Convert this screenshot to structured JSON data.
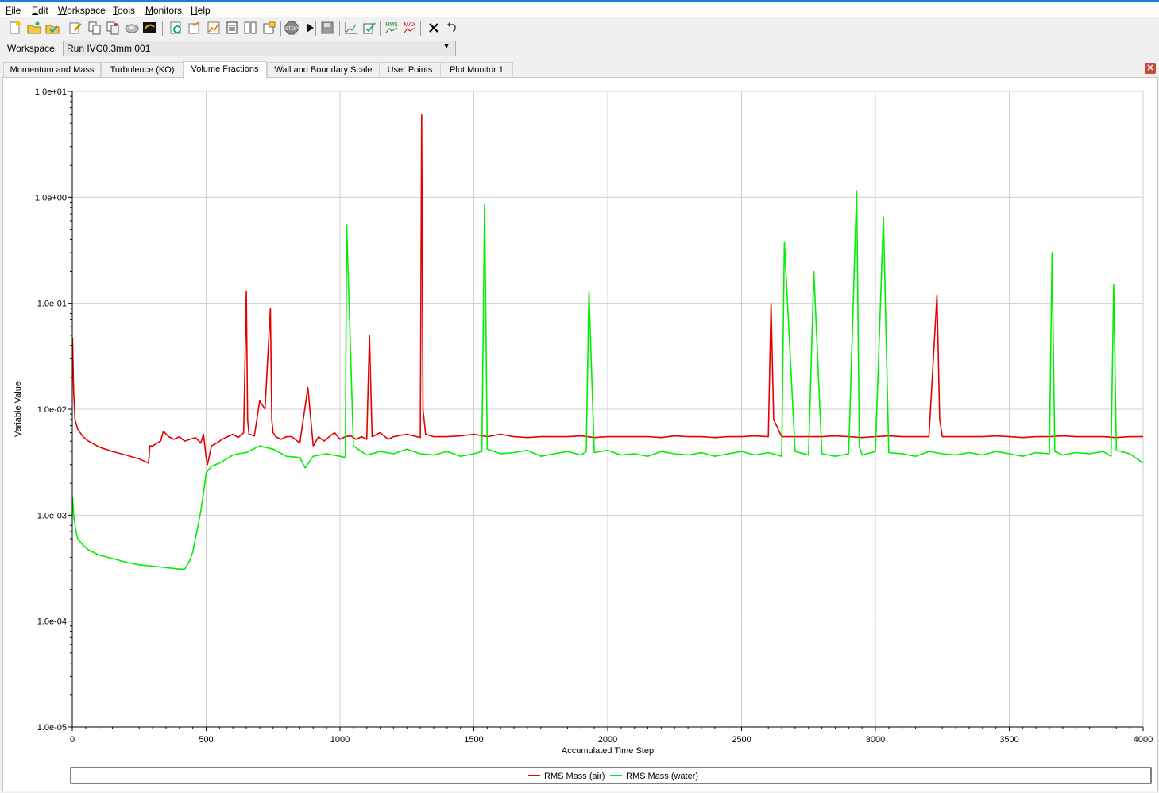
{
  "menu": [
    "File",
    "Edit",
    "Workspace",
    "Tools",
    "Monitors",
    "Help"
  ],
  "toolbar_icons": [
    "new-icon",
    "open-icon",
    "open-folder-icon",
    "edit-icon",
    "copy-icon",
    "copy-run-icon",
    "disk-icon",
    "monitor-icon",
    "refresh-icon",
    "run-icon",
    "chart-icon",
    "report-icon",
    "layout-icon",
    "tree-icon",
    "stop-icon",
    "play-icon",
    "save-icon",
    "plot-edit-icon",
    "plot-check-icon",
    "rms-icon",
    "max-icon",
    "close-icon",
    "undo-icon"
  ],
  "workspace": {
    "label": "Workspace",
    "value": "Run IVC0.3mm 001"
  },
  "tabs": [
    {
      "label": "Momentum and Mass"
    },
    {
      "label": "Turbulence (KO)"
    },
    {
      "label": "Volume Fractions",
      "active": true
    },
    {
      "label": "Wall and Boundary Scale"
    },
    {
      "label": "User Points"
    },
    {
      "label": "Plot Monitor 1"
    }
  ],
  "chart_data": {
    "type": "line",
    "xlabel": "Accumulated Time Step",
    "ylabel": "Variable Value",
    "yscale": "log",
    "xlim": [
      0,
      4000
    ],
    "ylim": [
      1e-05,
      10
    ],
    "xticks": [
      0,
      500,
      1000,
      1500,
      2000,
      2500,
      3000,
      3500,
      4000
    ],
    "xtick_labels": [
      "0",
      "500",
      "1000",
      "1500",
      "2000",
      "2500",
      "3000",
      "3500",
      "4000"
    ],
    "yticks": [
      1e-05,
      0.0001,
      0.001,
      0.01,
      0.1,
      1,
      10
    ],
    "ytick_labels": [
      "1.0e-05",
      "1.0e-04",
      "1.0e-03",
      "1.0e-02",
      "1.0e-01",
      "1.0e+00",
      "1.0e+01"
    ],
    "grid": true,
    "legend_position": "bottom",
    "series": [
      {
        "name": "RMS Mass (air)",
        "color": "#e60000",
        "x": [
          1,
          5,
          10,
          20,
          40,
          60,
          100,
          150,
          200,
          250,
          285,
          290,
          300,
          330,
          340,
          360,
          380,
          400,
          420,
          440,
          460,
          480,
          490,
          500,
          505,
          520,
          540,
          560,
          580,
          600,
          620,
          640,
          650,
          655,
          660,
          680,
          700,
          720,
          740,
          745,
          750,
          760,
          780,
          800,
          820,
          850,
          880,
          900,
          920,
          940,
          960,
          980,
          1000,
          1020,
          1040,
          1060,
          1080,
          1100,
          1110,
          1120,
          1150,
          1180,
          1200,
          1250,
          1300,
          1305,
          1310,
          1320,
          1350,
          1400,
          1450,
          1500,
          1550,
          1600,
          1650,
          1700,
          1750,
          1800,
          1850,
          1900,
          1950,
          2000,
          2050,
          2100,
          2150,
          2200,
          2250,
          2300,
          2350,
          2400,
          2450,
          2500,
          2550,
          2600,
          2610,
          2620,
          2650,
          2700,
          2750,
          2800,
          2850,
          2900,
          2950,
          3000,
          3050,
          3100,
          3150,
          3200,
          3230,
          3240,
          3250,
          3300,
          3350,
          3400,
          3450,
          3500,
          3550,
          3600,
          3650,
          3700,
          3750,
          3800,
          3850,
          3900,
          3950,
          4000
        ],
        "y": [
          0.047,
          0.015,
          0.008,
          0.0065,
          0.0055,
          0.005,
          0.0044,
          0.004,
          0.0037,
          0.0034,
          0.0031,
          0.0045,
          0.0045,
          0.005,
          0.0062,
          0.0055,
          0.0052,
          0.0055,
          0.005,
          0.0052,
          0.0054,
          0.0048,
          0.0058,
          0.0035,
          0.003,
          0.0045,
          0.0048,
          0.0052,
          0.0055,
          0.0058,
          0.0054,
          0.006,
          0.13,
          0.008,
          0.0058,
          0.0056,
          0.012,
          0.01,
          0.09,
          0.008,
          0.006,
          0.0055,
          0.0052,
          0.0055,
          0.0055,
          0.0048,
          0.016,
          0.0045,
          0.0055,
          0.005,
          0.0055,
          0.006,
          0.0052,
          0.0055,
          0.0056,
          0.0052,
          0.0055,
          0.0052,
          0.05,
          0.0055,
          0.006,
          0.0052,
          0.0055,
          0.0058,
          0.0054,
          6.0,
          0.01,
          0.0058,
          0.0055,
          0.0055,
          0.0056,
          0.0058,
          0.0055,
          0.0058,
          0.0055,
          0.0054,
          0.0055,
          0.0055,
          0.0055,
          0.0056,
          0.0054,
          0.0055,
          0.0055,
          0.0055,
          0.0055,
          0.0054,
          0.0056,
          0.0055,
          0.0055,
          0.0054,
          0.0055,
          0.0055,
          0.0056,
          0.0055,
          0.1,
          0.008,
          0.0055,
          0.0055,
          0.0055,
          0.0055,
          0.0056,
          0.0055,
          0.0054,
          0.0055,
          0.0056,
          0.0055,
          0.0055,
          0.0055,
          0.12,
          0.008,
          0.0055,
          0.0055,
          0.0055,
          0.0055,
          0.0056,
          0.0055,
          0.0054,
          0.0055,
          0.0055,
          0.0056,
          0.0055,
          0.0055,
          0.0055,
          0.0054,
          0.0055,
          0.0055
        ]
      },
      {
        "name": "RMS Mass (water)",
        "color": "#00ee00",
        "x": [
          1,
          5,
          10,
          20,
          40,
          60,
          100,
          150,
          200,
          250,
          300,
          350,
          400,
          410,
          420,
          430,
          440,
          450,
          460,
          470,
          480,
          490,
          500,
          520,
          550,
          600,
          620,
          650,
          700,
          750,
          800,
          850,
          870,
          900,
          950,
          1000,
          1020,
          1025,
          1050,
          1100,
          1150,
          1200,
          1250,
          1300,
          1350,
          1400,
          1450,
          1500,
          1530,
          1540,
          1550,
          1600,
          1650,
          1700,
          1750,
          1800,
          1850,
          1900,
          1920,
          1930,
          1950,
          2000,
          2050,
          2100,
          2150,
          2200,
          2250,
          2300,
          2350,
          2400,
          2450,
          2500,
          2550,
          2600,
          2650,
          2660,
          2700,
          2750,
          2770,
          2800,
          2850,
          2900,
          2930,
          2940,
          2950,
          3000,
          3030,
          3050,
          3100,
          3150,
          3200,
          3250,
          3300,
          3350,
          3400,
          3450,
          3500,
          3550,
          3600,
          3650,
          3660,
          3670,
          3700,
          3750,
          3800,
          3850,
          3880,
          3890,
          3900,
          3950,
          4000
        ],
        "y": [
          0.0015,
          0.001,
          0.0008,
          0.0006,
          0.00052,
          0.00047,
          0.00042,
          0.00039,
          0.00036,
          0.00034,
          0.00033,
          0.00032,
          0.00031,
          0.00031,
          0.00031,
          0.00034,
          0.00038,
          0.00045,
          0.0006,
          0.0008,
          0.0011,
          0.0016,
          0.0025,
          0.0029,
          0.0031,
          0.0037,
          0.0038,
          0.0039,
          0.0045,
          0.0042,
          0.0036,
          0.0035,
          0.0028,
          0.0036,
          0.0038,
          0.0036,
          0.0035,
          0.55,
          0.0045,
          0.0037,
          0.004,
          0.0038,
          0.0042,
          0.0038,
          0.0037,
          0.004,
          0.0036,
          0.0038,
          0.004,
          0.85,
          0.0042,
          0.0038,
          0.0039,
          0.0041,
          0.0036,
          0.0038,
          0.004,
          0.0037,
          0.004,
          0.13,
          0.0039,
          0.0041,
          0.0037,
          0.0038,
          0.0036,
          0.004,
          0.0038,
          0.0037,
          0.0039,
          0.0036,
          0.0038,
          0.004,
          0.0037,
          0.0039,
          0.0036,
          0.38,
          0.004,
          0.0037,
          0.2,
          0.0038,
          0.0036,
          0.0038,
          1.15,
          0.0045,
          0.0037,
          0.004,
          0.65,
          0.0039,
          0.0038,
          0.0036,
          0.004,
          0.0038,
          0.0037,
          0.0039,
          0.0037,
          0.004,
          0.0038,
          0.0036,
          0.0039,
          0.0038,
          0.3,
          0.004,
          0.0037,
          0.0039,
          0.0038,
          0.004,
          0.0036,
          0.15,
          0.0041,
          0.0038,
          0.0031
        ]
      }
    ]
  }
}
